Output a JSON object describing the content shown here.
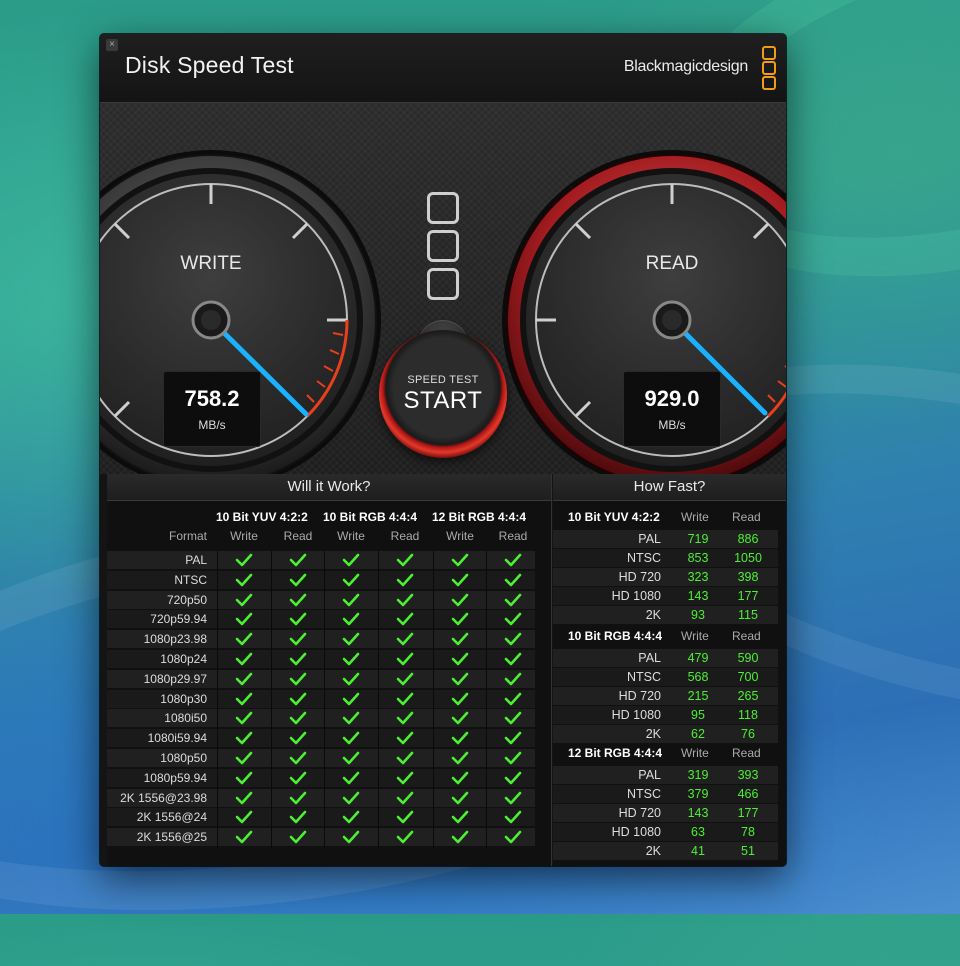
{
  "window": {
    "title": "Disk Speed Test",
    "brand": "Blackmagicdesign"
  },
  "gauges": {
    "write": {
      "label": "WRITE",
      "value": "758.2",
      "unit": "MB/s"
    },
    "read": {
      "label": "READ",
      "value": "929.0",
      "unit": "MB/s"
    }
  },
  "start_button": {
    "small_label": "SPEED TEST",
    "big_label": "START"
  },
  "will_it_work": {
    "title": "Will it Work?",
    "format_header": "Format",
    "groups": [
      "10 Bit YUV 4:2:2",
      "10 Bit RGB 4:4:4",
      "12 Bit RGB 4:4:4"
    ],
    "sub_headers": [
      "Write",
      "Read"
    ],
    "formats": [
      "PAL",
      "NTSC",
      "720p50",
      "720p59.94",
      "1080p23.98",
      "1080p24",
      "1080p29.97",
      "1080p30",
      "1080i50",
      "1080i59.94",
      "1080p50",
      "1080p59.94",
      "2K 1556@23.98",
      "2K 1556@24",
      "2K 1556@25"
    ],
    "all_supported": true
  },
  "how_fast": {
    "title": "How Fast?",
    "sub_headers": [
      "Write",
      "Read"
    ],
    "groups": [
      {
        "name": "10 Bit YUV 4:2:2",
        "rows": [
          {
            "label": "PAL",
            "write": "719",
            "read": "886"
          },
          {
            "label": "NTSC",
            "write": "853",
            "read": "1050"
          },
          {
            "label": "HD 720",
            "write": "323",
            "read": "398"
          },
          {
            "label": "HD 1080",
            "write": "143",
            "read": "177"
          },
          {
            "label": "2K",
            "write": "93",
            "read": "115"
          }
        ]
      },
      {
        "name": "10 Bit RGB 4:4:4",
        "rows": [
          {
            "label": "PAL",
            "write": "479",
            "read": "590"
          },
          {
            "label": "NTSC",
            "write": "568",
            "read": "700"
          },
          {
            "label": "HD 720",
            "write": "215",
            "read": "265"
          },
          {
            "label": "HD 1080",
            "write": "95",
            "read": "118"
          },
          {
            "label": "2K",
            "write": "62",
            "read": "76"
          }
        ]
      },
      {
        "name": "12 Bit RGB 4:4:4",
        "rows": [
          {
            "label": "PAL",
            "write": "319",
            "read": "393"
          },
          {
            "label": "NTSC",
            "write": "379",
            "read": "466"
          },
          {
            "label": "HD 720",
            "write": "143",
            "read": "177"
          },
          {
            "label": "HD 1080",
            "write": "63",
            "read": "78"
          },
          {
            "label": "2K",
            "write": "41",
            "read": "51"
          }
        ]
      }
    ]
  },
  "colors": {
    "accent_orange": "#f39a1b",
    "needle_blue": "#1ab2ff",
    "value_green": "#4cf033",
    "read_ring_red": "#c2161c"
  },
  "icons": [
    "close-icon",
    "gear-icon",
    "checkmark-icon",
    "blackmagic-logo-icon"
  ]
}
